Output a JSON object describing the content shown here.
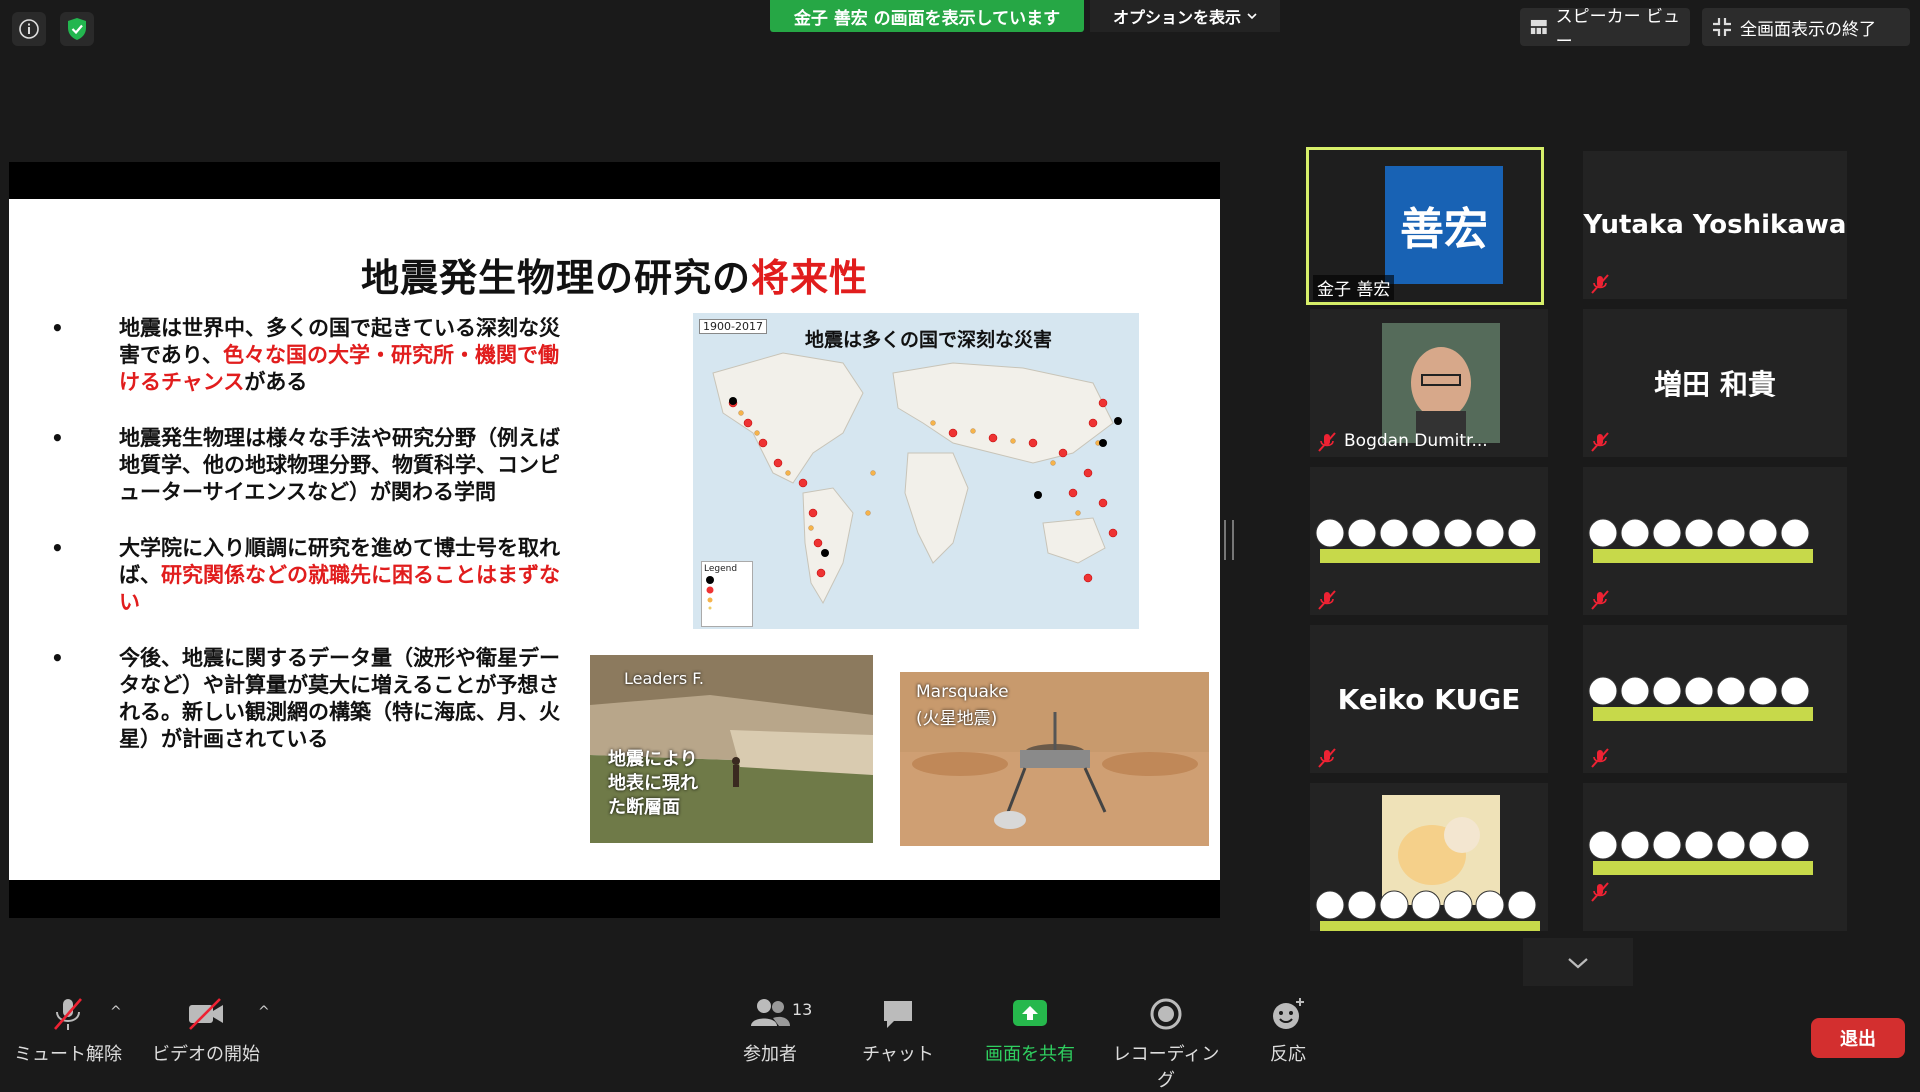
{
  "top_bar": {
    "info_icon": "info-icon",
    "shield_icon": "shield-check-icon",
    "share_banner": "金子 善宏 の画面を表示しています",
    "options_label": "オプションを表示",
    "speaker_view_label": "スピーカー ビュー",
    "exit_fullscreen_label": "全画面表示の終了"
  },
  "slide": {
    "title_main": "地震発生物理の研究の",
    "title_highlight": "将来性",
    "bullets": [
      {
        "pre": "地震は世界中、多くの国で起きている深刻な災害であり、",
        "red": "色々な国の大学・研究所・機関で働けるチャンス",
        "post": "がある"
      },
      {
        "pre": "地震発生物理は様々な手法や研究分野（例えば地質学、他の地球物理分野、物質科学、コンピューターサイエンスなど）が関わる学問",
        "red": "",
        "post": ""
      },
      {
        "pre": "大学院に入り順調に研究を進めて博士号を取れば、",
        "red": "研究関係などの就職先に困ることはまずない",
        "post": ""
      },
      {
        "pre": "今後、地震に関するデータ量（波形や衛星データなど）や計算量が莫大に増えることが予想される。新しい観測網の構築（特に海底、月、火星）が計画されている",
        "red": "",
        "post": ""
      }
    ],
    "map_year": "1900-2017",
    "map_caption": "地震は多くの国で深刻な災害",
    "map_legend": "Legend",
    "photo1_credit": "Leaders F.",
    "photo1_caption_l1": "地震により",
    "photo1_caption_l2": "地表に現れ",
    "photo1_caption_l3": "た断層面",
    "photo2_caption_l1": "Marsquake",
    "photo2_caption_l2": "(火星地震)"
  },
  "participants": [
    {
      "display": "善宏",
      "label": "金子 善宏",
      "active": true
    },
    {
      "display": "Yutaka Yoshikawa",
      "label": ""
    },
    {
      "display": "",
      "label": "Bogdan Dumitr..."
    },
    {
      "display": "増田 和貴",
      "label": ""
    },
    {
      "display": "",
      "label": ""
    },
    {
      "display": "",
      "label": ""
    },
    {
      "display": "Keiko KUGE",
      "label": ""
    },
    {
      "display": "",
      "label": ""
    },
    {
      "display": "",
      "label": ""
    },
    {
      "display": "",
      "label": ""
    }
  ],
  "toolbar": {
    "unmute": "ミュート解除",
    "start_video": "ビデオの開始",
    "participants_label": "参加者",
    "participants_count": "13",
    "chat": "チャット",
    "share_screen": "画面を共有",
    "recording": "レコーディング",
    "reactions": "反応",
    "exit": "退出"
  },
  "colors": {
    "accent_green": "#26a745",
    "active_speaker_border": "#d7ef6a",
    "exit_red": "#d32f2f",
    "slide_red": "#e11d1d",
    "avatar_blue": "#1862b4"
  }
}
